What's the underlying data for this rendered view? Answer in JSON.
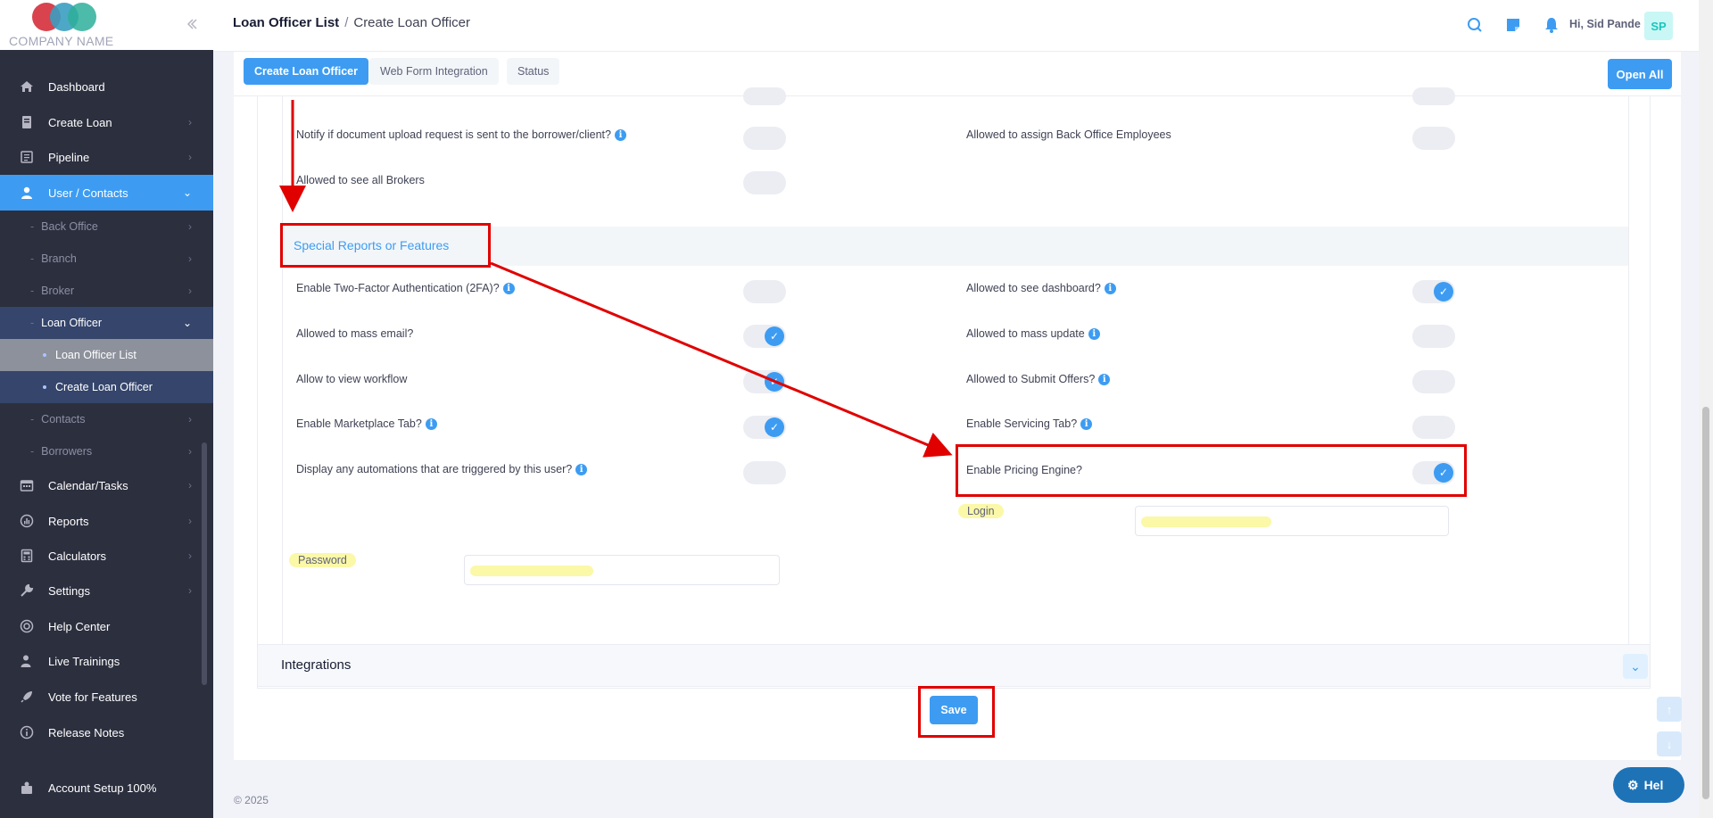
{
  "logo": {
    "text": "COMPANY NAME"
  },
  "header": {
    "breadcrumb_root": "Loan Officer List",
    "breadcrumb_sep": "/",
    "breadcrumb_current": "Create Loan Officer",
    "greeting": "Hi, Sid Pande",
    "avatar_initials": "SP"
  },
  "sidebar": {
    "items": [
      {
        "label": "Dashboard",
        "icon": "home-icon"
      },
      {
        "label": "Create Loan",
        "icon": "document-icon"
      },
      {
        "label": "Pipeline",
        "icon": "list-icon"
      },
      {
        "label": "User / Contacts",
        "icon": "users-icon"
      },
      {
        "label": "Calendar/Tasks",
        "icon": "calendar-icon"
      },
      {
        "label": "Reports",
        "icon": "chart-icon"
      },
      {
        "label": "Calculators",
        "icon": "calculator-icon"
      },
      {
        "label": "Settings",
        "icon": "wrench-icon"
      },
      {
        "label": "Help Center",
        "icon": "lifebuoy-icon"
      },
      {
        "label": "Live Trainings",
        "icon": "trainer-icon"
      },
      {
        "label": "Vote for Features",
        "icon": "rocket-icon"
      },
      {
        "label": "Release Notes",
        "icon": "info-icon"
      },
      {
        "label": "Account Setup 100%",
        "icon": "setup-icon"
      }
    ],
    "sub_items": [
      "Back Office",
      "Branch",
      "Broker",
      "Loan Officer",
      "Contacts",
      "Borrowers"
    ],
    "loan_officer_children": [
      "Loan Officer List",
      "Create Loan Officer"
    ]
  },
  "tabs": [
    "Create Loan Officer",
    "Web Form Integration",
    "Status"
  ],
  "open_all_label": "Open All",
  "permissions": {
    "rows_top": [
      {
        "label": "Notify if document upload request is sent to the borrower/client?",
        "info": true,
        "on": false
      },
      {
        "label": "Allowed to assign Back Office Employees",
        "info": false,
        "on": false
      },
      {
        "label": "Allowed to see all Brokers",
        "info": false,
        "on": false
      }
    ]
  },
  "special_section": {
    "title": "Special Reports or Features",
    "left": [
      {
        "label": "Enable Two-Factor Authentication (2FA)?",
        "info": true,
        "on": false
      },
      {
        "label": "Allowed to mass email?",
        "info": false,
        "on": true
      },
      {
        "label": "Allow to view workflow",
        "info": false,
        "on": true
      },
      {
        "label": "Enable Marketplace Tab?",
        "info": true,
        "on": true
      },
      {
        "label": "Display any automations that are triggered by this user?",
        "info": true,
        "on": false
      }
    ],
    "right": [
      {
        "label": "Allowed to see dashboard?",
        "info": true,
        "on": true
      },
      {
        "label": "Allowed to mass update",
        "info": true,
        "on": false
      },
      {
        "label": "Allowed to Submit Offers?",
        "info": true,
        "on": false
      },
      {
        "label": "Enable Servicing Tab?",
        "info": true,
        "on": false
      },
      {
        "label": "Enable Pricing Engine?",
        "info": false,
        "on": true
      }
    ],
    "login_label": "Login",
    "password_label": "Password"
  },
  "integrations_title": "Integrations",
  "save_label": "Save",
  "footer": "© 2025",
  "help_label": "Hel",
  "colors": {
    "accent": "#3d9cf2",
    "sidebar": "#2c2f3e",
    "annotation": "#e00000",
    "highlight": "#fbf8a8"
  }
}
